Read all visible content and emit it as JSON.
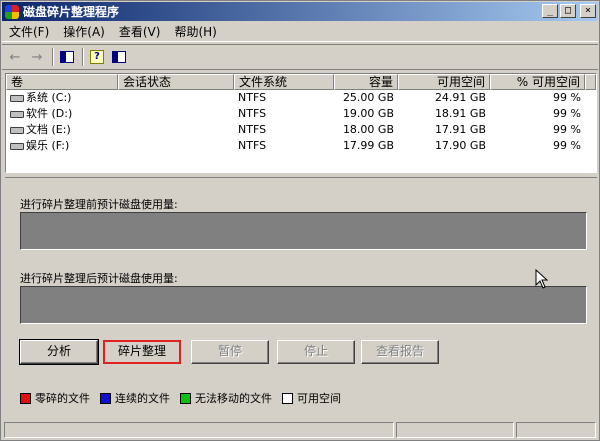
{
  "window": {
    "title": "磁盘碎片整理程序"
  },
  "title_buttons": {
    "minimize": "_",
    "maximize": "□",
    "close": "×"
  },
  "menu": [
    "文件(F)",
    "操作(A)",
    "查看(V)",
    "帮助(H)"
  ],
  "toolbar": [
    "back-arrow",
    "forward-arrow",
    "console-tree",
    "help",
    "properties"
  ],
  "columns": [
    "卷",
    "会话状态",
    "文件系统",
    "容量",
    "可用空间",
    "% 可用空间"
  ],
  "volumes": [
    {
      "name": "系统 (C:)",
      "status": "",
      "fs": "NTFS",
      "capacity": "25.00 GB",
      "free": "24.91 GB",
      "pct": "99 %"
    },
    {
      "name": "软件 (D:)",
      "status": "",
      "fs": "NTFS",
      "capacity": "19.00 GB",
      "free": "18.91 GB",
      "pct": "99 %"
    },
    {
      "name": "文档 (E:)",
      "status": "",
      "fs": "NTFS",
      "capacity": "18.00 GB",
      "free": "17.91 GB",
      "pct": "99 %"
    },
    {
      "name": "娱乐 (F:)",
      "status": "",
      "fs": "NTFS",
      "capacity": "17.99 GB",
      "free": "17.90 GB",
      "pct": "99 %"
    }
  ],
  "before_label": "进行碎片整理前预计磁盘使用量:",
  "after_label": "进行碎片整理后预计磁盘使用量:",
  "buttons": {
    "analyze": "分析",
    "defrag": "碎片整理",
    "pause": "暂停",
    "stop": "停止",
    "report": "查看报告"
  },
  "legend": [
    {
      "label": "零碎的文件",
      "color": "#e01010"
    },
    {
      "label": "连续的文件",
      "color": "#1010d0"
    },
    {
      "label": "无法移动的文件",
      "color": "#10c010"
    },
    {
      "label": "可用空间",
      "color": "#ffffff"
    }
  ]
}
